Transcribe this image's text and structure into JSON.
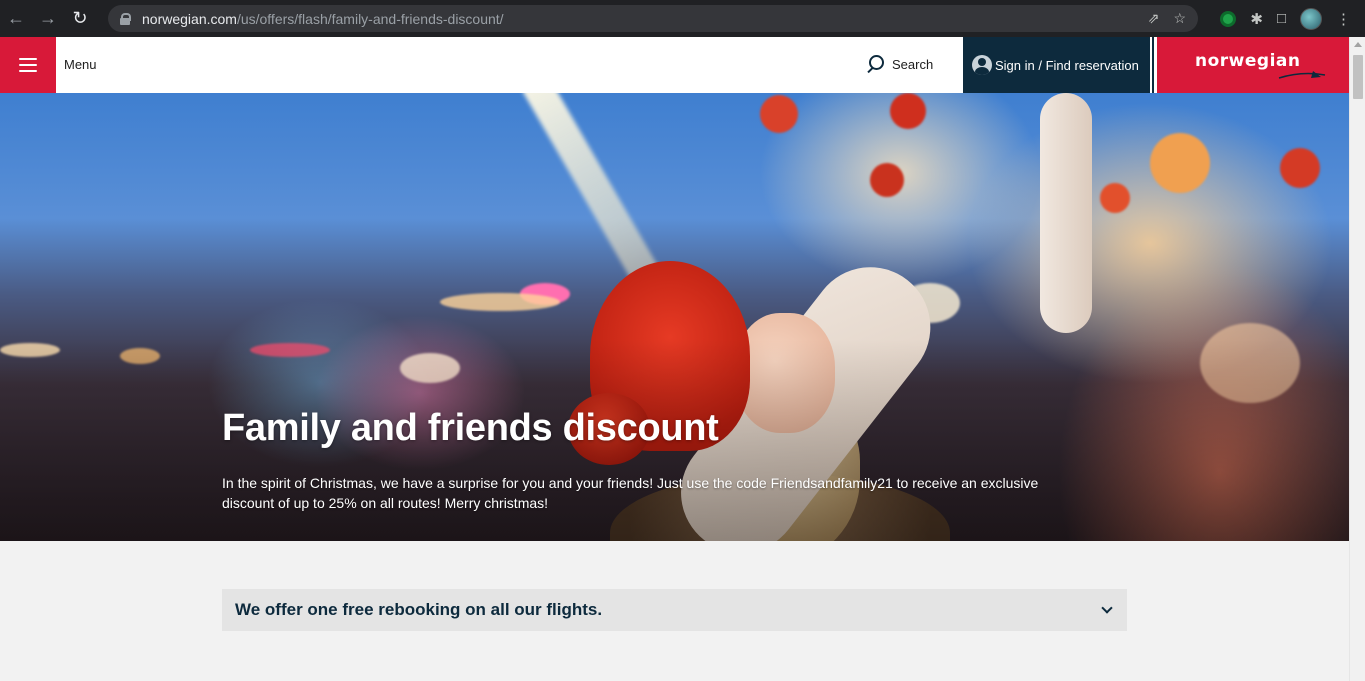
{
  "browser": {
    "url_host": "norwegian.com",
    "url_path": "/us/offers/flash/family-and-friends-discount/",
    "icons": [
      "back-icon",
      "forward-icon",
      "reload-icon",
      "lock-icon",
      "share-icon",
      "star-icon",
      "extension-icon",
      "puzzle-icon",
      "sidepanel-icon",
      "profile-avatar",
      "kebab-menu-icon"
    ]
  },
  "header": {
    "menu_label": "Menu",
    "search_label": "Search",
    "signin_label": "Sign in / Find reservation",
    "logo_text": "norwegian"
  },
  "hero": {
    "title": "Family and friends discount",
    "description": "In the spirit of Christmas, we have a surprise for you and your friends! Just use the code Friendsandfamily21 to receive an exclusive discount of up to 25% on all routes! Merry christmas!"
  },
  "accordion": {
    "title": "We offer one free rebooking on all our flights."
  },
  "colors": {
    "brand_red": "#d81939",
    "brand_navy": "#0d2a3d",
    "chrome_dark": "#202124"
  }
}
